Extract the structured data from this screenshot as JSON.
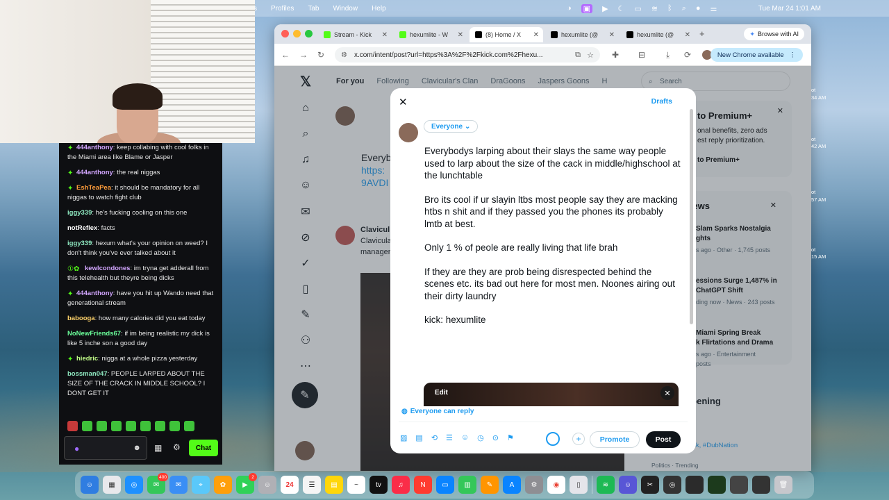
{
  "menubar": {
    "items": [
      "s",
      "Profiles",
      "Tab",
      "Window",
      "Help"
    ],
    "clock": "Tue Mar 24  1:01 AM"
  },
  "chat": {
    "messages": [
      {
        "user": "444anthony",
        "user_color": "#d2a6ff",
        "badge": "✦",
        "text": "keep collabing with cool folks in the Miami area like Blame or Jasper"
      },
      {
        "user": "444anthony",
        "user_color": "#d2a6ff",
        "badge": "✦",
        "text": "the real niggas"
      },
      {
        "user": "EshTeaPea",
        "user_color": "#ff9d3b",
        "badge": "✦",
        "text": "it should be mandatory for all niggas to watch fight club"
      },
      {
        "user": "iggy339",
        "user_color": "#8ee8c0",
        "badge": "",
        "text": "he's fucking cooling on this one"
      },
      {
        "user": "notReflex",
        "user_color": "#ffffff",
        "badge": "",
        "text": "facts"
      },
      {
        "user": "iggy339",
        "user_color": "#8ee8c0",
        "badge": "",
        "text": "hexum what's your opinion on weed? I don't think you've ever talked about it"
      },
      {
        "user": "kewlcondones",
        "user_color": "#d2a6ff",
        "badge": "①✿",
        "text": "im tryna get adderall from this telehealth but theyre being dicks"
      },
      {
        "user": "444anthony",
        "user_color": "#d2a6ff",
        "badge": "✦",
        "text": "have you hit up Wando need that generational stream"
      },
      {
        "user": "babooga",
        "user_color": "#ffd36b",
        "badge": "",
        "text": "how many calories did you eat today"
      },
      {
        "user": "NoNewFriends67",
        "user_color": "#6bff9a",
        "badge": "",
        "text": "if im being realistic my dick is like 5 inche son a good day"
      },
      {
        "user": "hiedric",
        "user_color": "#c3ff8a",
        "badge": "✦",
        "text": "nigga at a whole pizza yesterday"
      },
      {
        "user": "bossman047",
        "user_color": "#8ee8c0",
        "badge": "",
        "text": "PEOPLE LARPED ABOUT THE SIZE OF THE CRACK IN MIDDLE SCHOOL? I DONT GET IT"
      }
    ],
    "send_label": "Chat"
  },
  "browser": {
    "tabs": [
      {
        "title": "Stream - Kick",
        "color": "#53fc18"
      },
      {
        "title": "hexumlite - W",
        "color": "#53fc18"
      },
      {
        "title": "(8) Home / X",
        "color": "#000000"
      },
      {
        "title": "hexumlite (@",
        "color": "#000000"
      },
      {
        "title": "hexumlite (@",
        "color": "#000000"
      }
    ],
    "browse_ai": "Browse with AI",
    "url": "x.com/intent/post?url=https%3A%2F%2Fkick.com%2Fhexu...",
    "new_chrome": "New Chrome available"
  },
  "x": {
    "tabs": [
      "For you",
      "Following",
      "Clavicular's Clan",
      "DraGoons",
      "Jaspers Goons",
      "H"
    ],
    "search_placeholder": "Search",
    "feed_partial": [
      "Everyb",
      "https:",
      "9AVDI",
      "Clavicul",
      "Clavicula",
      "manager"
    ],
    "right_premium": [
      "to Premium+",
      "onal benefits, zero ads",
      "est reply prioritization.",
      "to Premium+"
    ],
    "news_title": "News",
    "news_items": [
      {
        "title": "Slam Sparks Nostalgia",
        "title2": "ghts",
        "meta": "s ago · Other · 1,745 posts"
      },
      {
        "title": "essions Surge 1,487% in",
        "title2": "ChatGPT Shift",
        "meta": "ding now · News · 243 posts"
      },
      {
        "title": "Miami Spring Break",
        "title2": "k Flirtations and Drama",
        "meta": "s ago · Entertainment",
        "meta2": "posts"
      }
    ],
    "happening": "appening",
    "happening_sub": "dy",
    "happening_tags": "Punk, #DubNation",
    "trending_meta": "Politics · Trending"
  },
  "compose": {
    "drafts": "Drafts",
    "audience": "Everyone",
    "paragraphs": [
      "Everybodys larping about their slays the same way people used to larp about the size of the cack in middle/highschool at the lunchtable",
      "Bro its cool if ur slayin ltbs most people say they are macking htbs n shit and if they passed you the phones its probably lmtb at best.",
      "Only 1 % of peole are really living that life brah",
      "If they are they are prob being disrespected behind the scenes etc. its bad out here for most men. Noones airing out their dirty laundry",
      "kick: hexumlite"
    ],
    "edit_label": "Edit",
    "reply_setting": "Everyone can reply",
    "promote_label": "Promote",
    "post_label": "Post"
  },
  "side_notes": [
    "ot",
    "34 AM",
    "ot",
    "42 AM",
    "ot",
    "57 AM",
    "ot",
    "15 AM"
  ],
  "dock": {
    "badges": {
      "messages": "400",
      "facetime": "2"
    },
    "calendar_day": "24"
  }
}
